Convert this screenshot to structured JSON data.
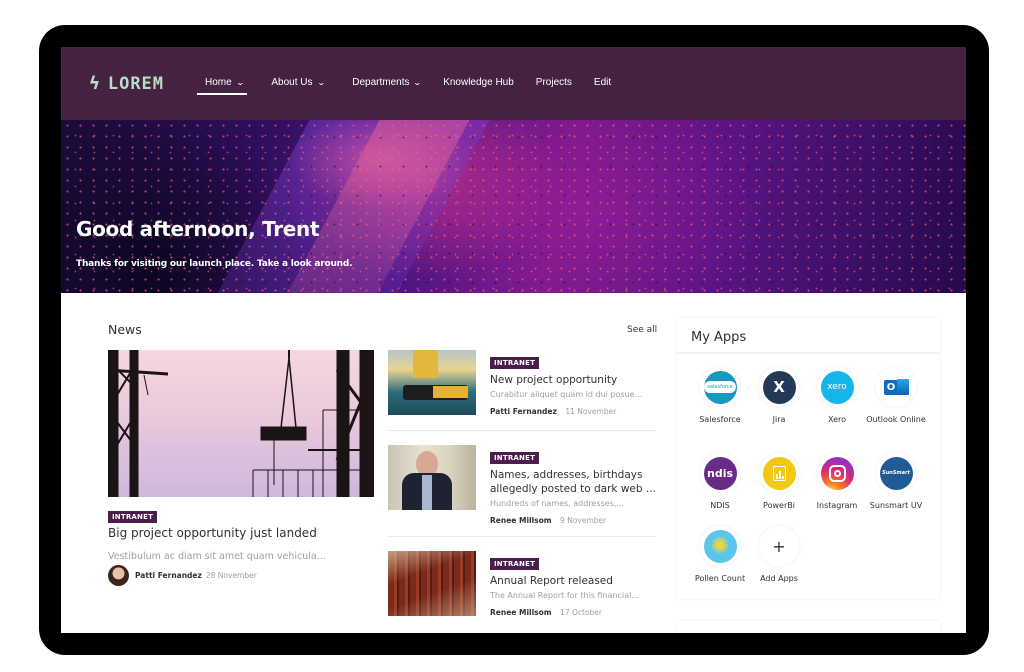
{
  "nav": {
    "logo": {
      "icon": "lightning-bolt-icon",
      "text": "LOREM"
    },
    "items": [
      {
        "label": "Home",
        "dropdown": true,
        "active": true
      },
      {
        "label": "About Us",
        "dropdown": true
      },
      {
        "label": "Departments",
        "dropdown": true
      },
      {
        "label": "Knowledge Hub"
      },
      {
        "label": "Projects"
      },
      {
        "label": "Edit"
      }
    ],
    "chevron": "⌄",
    "bolt": "ϟ"
  },
  "hero": {
    "title": "Good afternoon, Trent",
    "subtitle": "Thanks for visiting our launch place. Take a look around."
  },
  "news": {
    "title": "News",
    "see_all": "See all",
    "featured": {
      "badge": "INTRANET",
      "headline": "Big project opportunity just landed",
      "description": "Vestibulum ac diam sit amet quam vehicula...",
      "author": "Patti Fernandez",
      "date": "28 November"
    },
    "items": [
      {
        "badge": "INTRANET",
        "headline": "New project opportunity",
        "description": "Curabitur aliquet quam id dui posue...",
        "author": "Patti Fernandez",
        "date": "11 November"
      },
      {
        "badge": "INTRANET",
        "headline": "Names, addresses, birthdays allegedly posted to dark web ...",
        "description": "Hundreds of names, addresses,...",
        "author": "Renee Millsom",
        "date": "9 November"
      },
      {
        "badge": "INTRANET",
        "headline": "Annual Report released",
        "description": "The Annual Report for this financial...",
        "author": "Renee Millsom",
        "date": "17 October"
      }
    ]
  },
  "apps": {
    "title": "My Apps",
    "items": [
      {
        "label": "Salesforce",
        "icon": "salesforce-icon",
        "glyph": "salesforce",
        "color": "#1798c1"
      },
      {
        "label": "Jira",
        "icon": "jira-icon",
        "glyph": "X",
        "color": "#253858"
      },
      {
        "label": "Xero",
        "icon": "xero-icon",
        "glyph": "xero",
        "color": "#13b5ea"
      },
      {
        "label": "Outlook Online",
        "icon": "outlook-icon",
        "glyph": "O",
        "color": "#0f6cbd"
      },
      {
        "label": "NDIS",
        "icon": "ndis-icon",
        "glyph": "ndis",
        "color": "#6a2a87"
      },
      {
        "label": "PowerBi",
        "icon": "powerbi-icon",
        "glyph": "▮▮",
        "color": "#f2c811"
      },
      {
        "label": "Instagram",
        "icon": "instagram-icon",
        "glyph": "◎",
        "color": "#d62976"
      },
      {
        "label": "Sunsmart UV",
        "icon": "sunsmart-icon",
        "glyph": "SunSmart",
        "color": "#1f5b97"
      },
      {
        "label": "Pollen Count",
        "icon": "pollen-icon",
        "glyph": "✺",
        "color": "#5bc6ea"
      },
      {
        "label": "Add Apps",
        "icon": "plus-icon",
        "glyph": "+",
        "color": "#ffffff"
      }
    ]
  }
}
